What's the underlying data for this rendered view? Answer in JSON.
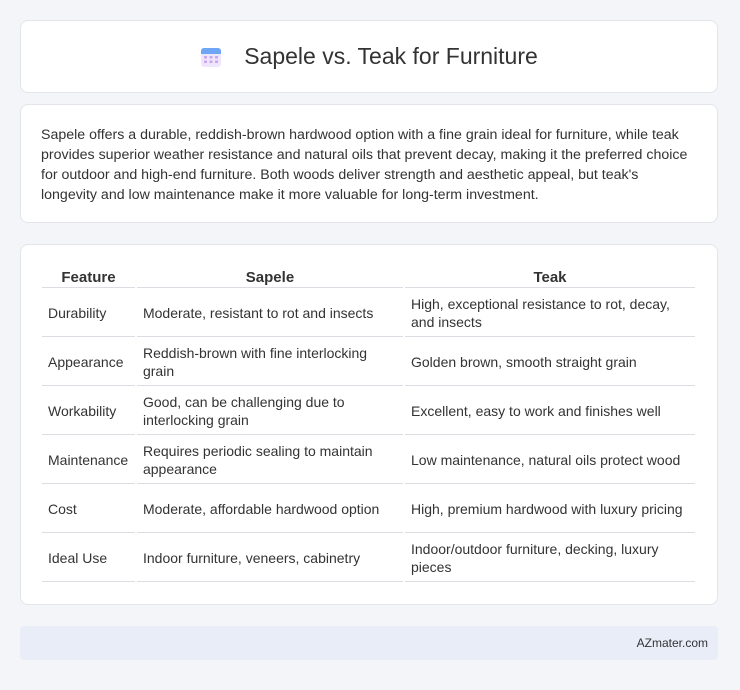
{
  "header": {
    "title": "Sapele vs. Teak for Furniture",
    "icon": "calendar-icon",
    "icon_colors": {
      "top": "#6ea6f5",
      "body": "#efe6fb",
      "dots": "#c7a6ef"
    }
  },
  "summary": {
    "text": "Sapele offers a durable, reddish-brown hardwood option with a fine grain ideal for furniture, while teak provides superior weather resistance and natural oils that prevent decay, making it the preferred choice for outdoor and high-end furniture. Both woods deliver strength and aesthetic appeal, but teak's longevity and low maintenance make it more valuable for long-term investment."
  },
  "table": {
    "headers": [
      "Feature",
      "Sapele",
      "Teak"
    ],
    "rows": [
      [
        "Durability",
        "Moderate, resistant to rot and insects",
        "High, exceptional resistance to rot, decay, and insects"
      ],
      [
        "Appearance",
        "Reddish-brown with fine interlocking grain",
        "Golden brown, smooth straight grain"
      ],
      [
        "Workability",
        "Good, can be challenging due to interlocking grain",
        "Excellent, easy to work and finishes well"
      ],
      [
        "Maintenance",
        "Requires periodic sealing to maintain appearance",
        "Low maintenance, natural oils protect wood"
      ],
      [
        "Cost",
        "Moderate, affordable hardwood option",
        "High, premium hardwood with luxury pricing"
      ],
      [
        "Ideal Use",
        "Indoor furniture, veneers, cabinetry",
        "Indoor/outdoor furniture, decking, luxury pieces"
      ]
    ]
  },
  "footer": {
    "brand": "AZmater.com"
  }
}
